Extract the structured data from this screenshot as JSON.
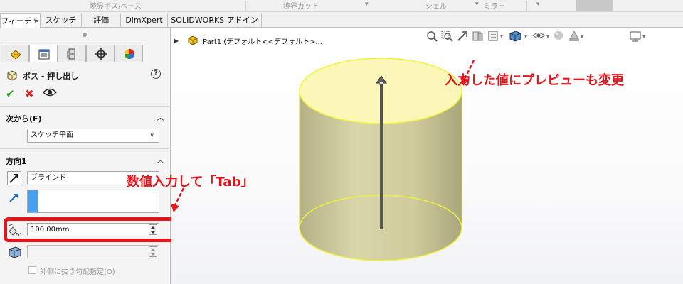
{
  "top_toolbar": {
    "items": [
      {
        "label": "境界ボス/ベース"
      },
      {
        "label": "境界カット"
      },
      {
        "label": "シェル"
      },
      {
        "label": "ミラー"
      }
    ]
  },
  "tabs": [
    {
      "label": "フィーチャー",
      "active": true
    },
    {
      "label": "スケッチ",
      "active": false
    },
    {
      "label": "評価",
      "active": false
    },
    {
      "label": "DimXpert",
      "active": false
    },
    {
      "label": "SOLIDWORKS アドイン",
      "active": false
    }
  ],
  "property_manager": {
    "panel_tabs": [
      "featuremanager-icon",
      "propertymanager-icon",
      "configurationmanager-icon",
      "dimxpert-icon",
      "display-manager-icon"
    ],
    "feature_title": "ボス - 押し出し",
    "help_symbol": "?",
    "from_section": {
      "header": "次から(F)",
      "value": "スケッチ平面"
    },
    "direction_section": {
      "header": "方向1",
      "end_condition": "ブラインド",
      "depth_value": "100.00mm",
      "draft_value": "",
      "outward_draft_label": "外側に抜き勾配指定(O)"
    }
  },
  "viewport": {
    "tree_part_label": "Part1 (デフォルト<<デフォルト>..."
  },
  "annotations": {
    "preview_note": "入力した値にプレビューも変更",
    "input_note": "数値入力して「Tab」",
    "color": "#e8141b"
  },
  "colors": {
    "accent_red": "#e8141b",
    "cylinder_face": "#d8d4a4",
    "cylinder_edge": "#f3f338",
    "list_blue": "#4aa0f0"
  }
}
